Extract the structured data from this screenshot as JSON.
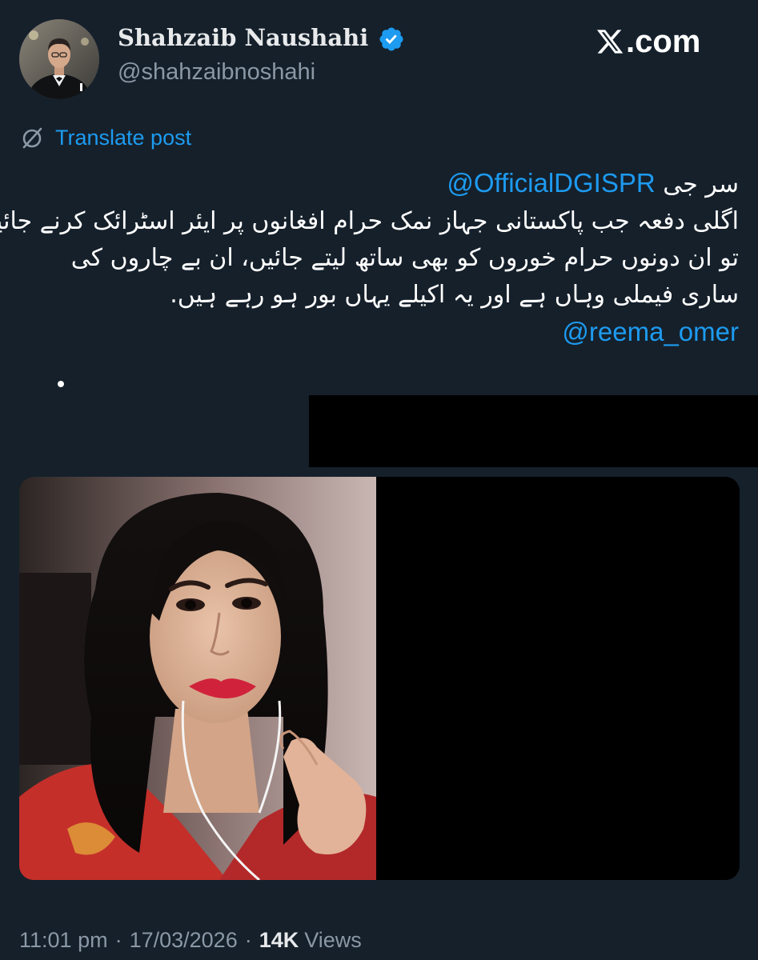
{
  "header": {
    "display_name": "Shahzaib Naushahi",
    "handle": "@shahzaibnoshahi",
    "site": ".com"
  },
  "translate": {
    "label": "Translate post"
  },
  "post": {
    "lines": [
      "سر جی",
      "اگلی دفعہ جب پاکستانی جہاز نمک حرام افغانوں پر ایئر اسٹرائک کرنے جائیں",
      "تو ان دونوں حرام خوروں کو بھی ساتھ لیتے جائیں، ان بے چاروں کی",
      "ساری فیملی وہاں ہے اور یہ اکیلے یہاں بور ہو رہے ہیں.",
      ""
    ],
    "mention_1": "@OfficialDGISPR",
    "mention_2": "@reema_omer"
  },
  "meta": {
    "time": "11:01 pm",
    "separator": "·",
    "date": "17/03/2026",
    "views_count": "14K",
    "views_label": "Views"
  },
  "colors": {
    "background": "#15202b",
    "accent": "#1d9bf0",
    "secondary_text": "#8b98a5",
    "primary_text": "#e7e9ea",
    "redaction": "#000000"
  },
  "icons": {
    "verified": "verified-badge-icon",
    "x_logo": "x-logo-icon",
    "translate": "translate-icon"
  }
}
